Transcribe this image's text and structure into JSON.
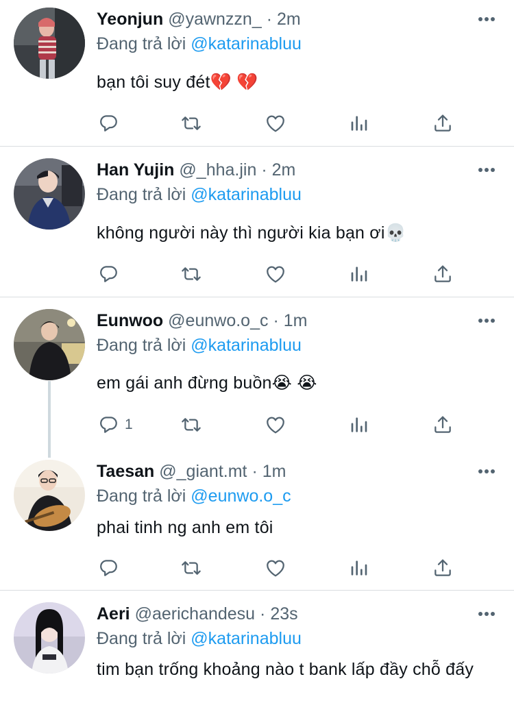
{
  "reply_prefix": "Đang trả lời",
  "tweets": [
    {
      "name": "Yeonjun",
      "handle": "@yawnzzn_",
      "dot": "·",
      "time": "2m",
      "reply_to": "@katarinabluu",
      "text": "bạn tôi suy đét💔 💔",
      "reply_count": ""
    },
    {
      "name": "Han Yujin",
      "handle": "@_hha.jin",
      "dot": "·",
      "time": "2m",
      "reply_to": "@katarinabluu",
      "text": "không người này thì người kia bạn ơi💀",
      "reply_count": ""
    },
    {
      "name": "Eunwoo",
      "handle": "@eunwo.o_c",
      "dot": "·",
      "time": "1m",
      "reply_to": "@katarinabluu",
      "text": "em gái anh đừng buồn😭 😭",
      "reply_count": "1"
    },
    {
      "name": "Taesan",
      "handle": "@_giant.mt",
      "dot": "·",
      "time": "1m",
      "reply_to": "@eunwo.o_c",
      "text": "phai tinh ng anh em tôi",
      "reply_count": ""
    },
    {
      "name": "Aeri",
      "handle": "@aerichandesu",
      "dot": "·",
      "time": "23s",
      "reply_to": "@katarinabluu",
      "text": "tim bạn trống khoảng nào t bank lấp đầy chỗ đấy",
      "reply_count": ""
    }
  ],
  "colors": {
    "accent": "#1d9bf0",
    "secondary_text": "#536471",
    "primary_text": "#0f1419",
    "divider": "#d9dde0",
    "thread_line": "#cfd9de"
  },
  "icons": [
    "reply-icon",
    "retweet-icon",
    "like-icon",
    "stats-icon",
    "share-icon",
    "more-icon"
  ]
}
